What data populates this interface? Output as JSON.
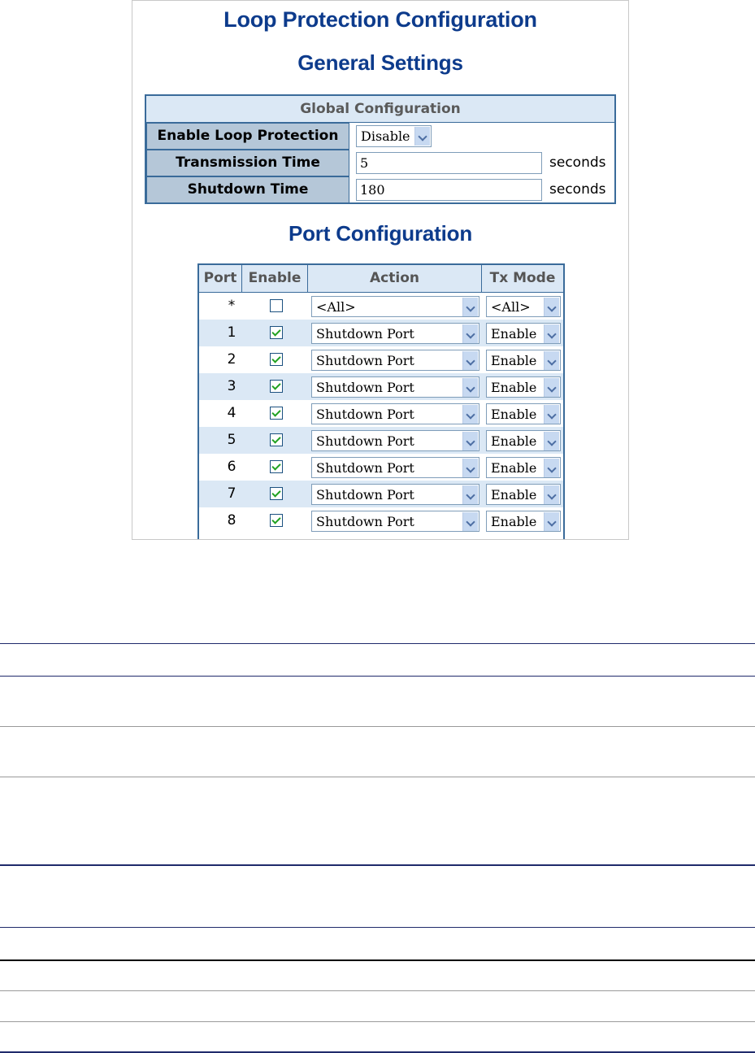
{
  "page": {
    "title": "Loop Protection Configuration",
    "general_title": "General Settings",
    "port_title": "Port Configuration"
  },
  "global": {
    "caption": "Global Configuration",
    "enable_label": "Enable Loop Protection",
    "enable_value": "Disable",
    "tx_label": "Transmission Time",
    "tx_value": "5",
    "tx_unit": "seconds",
    "shutdown_label": "Shutdown Time",
    "shutdown_value": "180",
    "shutdown_unit": "seconds"
  },
  "ports": {
    "headers": [
      "Port",
      "Enable",
      "Action",
      "Tx Mode"
    ],
    "rows": [
      {
        "port": "*",
        "enabled": false,
        "action": "<All>",
        "tx_mode": "<All>"
      },
      {
        "port": "1",
        "enabled": true,
        "action": "Shutdown Port",
        "tx_mode": "Enable"
      },
      {
        "port": "2",
        "enabled": true,
        "action": "Shutdown Port",
        "tx_mode": "Enable"
      },
      {
        "port": "3",
        "enabled": true,
        "action": "Shutdown Port",
        "tx_mode": "Enable"
      },
      {
        "port": "4",
        "enabled": true,
        "action": "Shutdown Port",
        "tx_mode": "Enable"
      },
      {
        "port": "5",
        "enabled": true,
        "action": "Shutdown Port",
        "tx_mode": "Enable"
      },
      {
        "port": "6",
        "enabled": true,
        "action": "Shutdown Port",
        "tx_mode": "Enable"
      },
      {
        "port": "7",
        "enabled": true,
        "action": "Shutdown Port",
        "tx_mode": "Enable"
      },
      {
        "port": "8",
        "enabled": true,
        "action": "Shutdown Port",
        "tx_mode": "Enable"
      }
    ]
  },
  "colors": {
    "title": "#0d3b8c",
    "table_border": "#3a6b9a",
    "label_bg": "#b5c7d8",
    "row_alt_bg": "#dbe8f5",
    "check_green": "#21a121"
  }
}
